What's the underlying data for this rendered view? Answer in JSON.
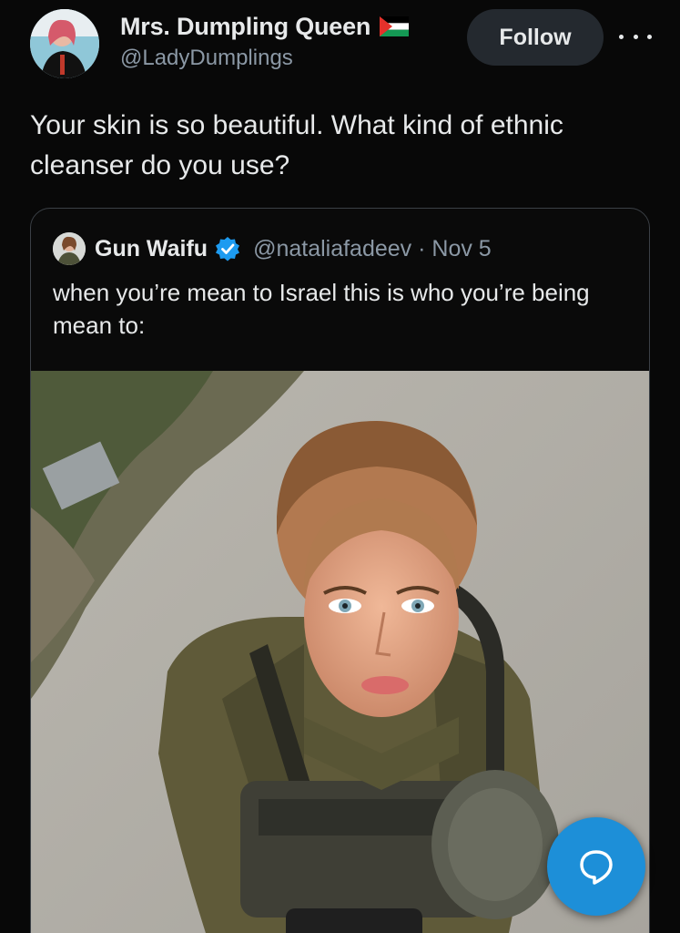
{
  "post": {
    "author_name": "Mrs. Dumpling Queen",
    "author_handle": "@LadyDumplings",
    "flag_icon": "palestine-flag-icon",
    "follow_label": "Follow",
    "text": "Your skin is so beautiful. What kind of ethnic cleanser do you use?"
  },
  "quoted": {
    "author_name": "Gun Waifu",
    "author_handle": "@nataliafadeev · Nov 5",
    "verified_icon": "verified-badge-icon",
    "text": "when you’re mean to Israel this is who you’re being mean to:",
    "photo_description_icon": "photo"
  },
  "actions": {
    "reply_icon": "reply-bubble-icon"
  },
  "colors": {
    "background": "#080808",
    "accent": "#1d8fd8",
    "secondary_text": "#8b98a5"
  }
}
